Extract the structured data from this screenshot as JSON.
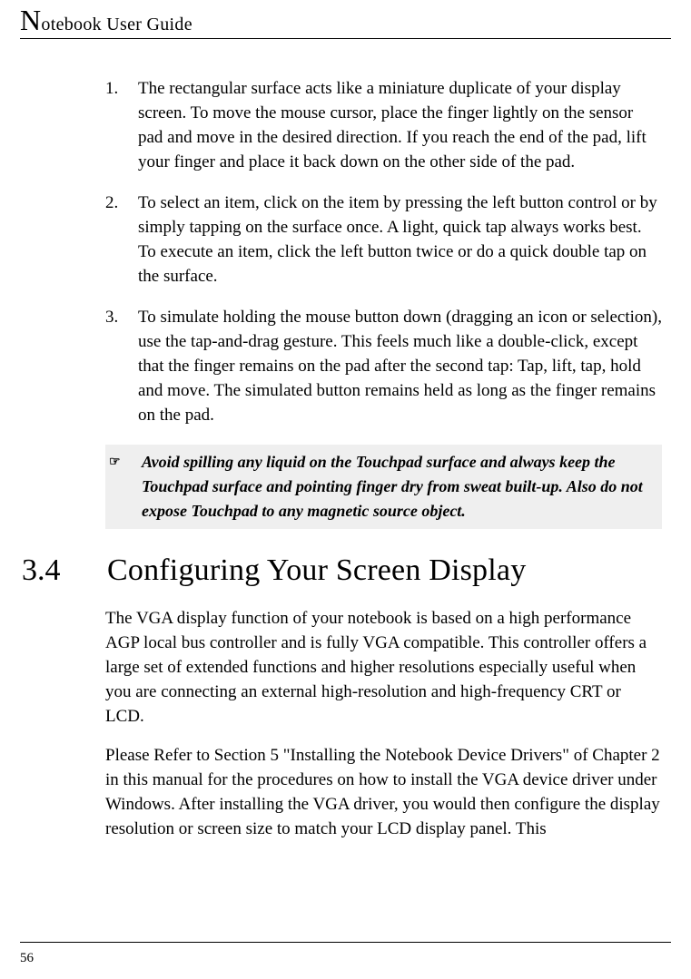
{
  "header": {
    "running_title_first": "N",
    "running_title_rest": "otebook User Guide"
  },
  "list": {
    "items": [
      {
        "num": "1.",
        "text": "The rectangular surface acts like a miniature duplicate of your display screen. To move the mouse cursor, place the finger lightly on the sensor pad and move in the desired direction. If you reach the end of the pad, lift your finger and place it back down on the other side of the pad."
      },
      {
        "num": "2.",
        "text": "To select an item, click on the item by pressing the left button control or by simply tapping on the surface once. A light, quick tap always works best. To execute an item, click the left button twice or do a quick double tap on the surface."
      },
      {
        "num": "3.",
        "text": "To simulate holding the mouse button down (dragging an icon or selection), use the tap-and-drag gesture. This feels much like a double-click, except that the finger remains on the pad after the second tap: Tap, lift, tap, hold and move. The simulated button remains held as long as the finger remains on the pad."
      }
    ]
  },
  "callout": {
    "icon_glyph": "☞",
    "text": "Avoid spilling any liquid on the Touchpad surface and always keep the Touchpad surface and pointing finger dry from sweat built-up. Also do not expose Touchpad to any magnetic source object."
  },
  "section": {
    "number": "3.4",
    "title": "Configuring Your Screen Display",
    "p1": "The VGA display function of your notebook is based on a high performance AGP local bus controller and is fully VGA compatible. This controller offers a large set of extended functions and higher resolutions especially useful when you are connecting an external high-resolution and high-frequency CRT or LCD.",
    "p2": "Please Refer to Section 5 \"Installing the Notebook Device Drivers\" of Chapter 2 in this manual for the procedures on how to install the VGA device driver under Windows. After installing the VGA driver, you would then configure the display resolution or screen size to match your LCD display panel. This"
  },
  "footer": {
    "page_number": "56"
  }
}
